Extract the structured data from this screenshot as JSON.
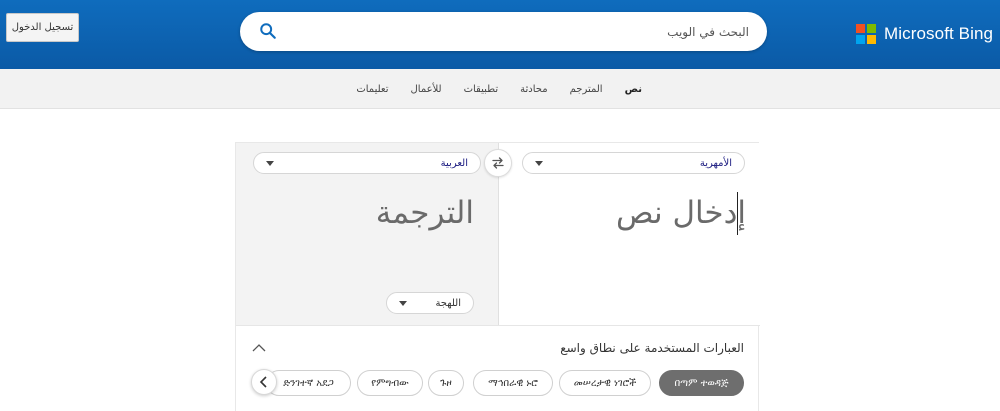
{
  "header": {
    "signin_label": "تسجيل الدخول",
    "search_placeholder": "البحث في الويب",
    "brand_name": "Microsoft Bing",
    "logo_colors": [
      "#f25022",
      "#7fba00",
      "#00a4ef",
      "#ffb900"
    ]
  },
  "tabs": [
    {
      "label": "نص",
      "active": true
    },
    {
      "label": "المترجم",
      "active": false
    },
    {
      "label": "محادثة",
      "active": false
    },
    {
      "label": "تطبيقات",
      "active": false
    },
    {
      "label": "للأعمال",
      "active": false
    },
    {
      "label": "تعليمات",
      "active": false
    }
  ],
  "translator": {
    "source_language": "الأمهرية",
    "target_language": "العربية",
    "source_placeholder": "إدخال نص",
    "target_placeholder": "الترجمة",
    "dialect_label": "اللهجة"
  },
  "phrases": {
    "title": "العبارات المستخدمة على نطاق واسع",
    "chips": [
      "በጣም ተወዳጅ",
      "መሠረታዊ ነገሮች",
      "ማኅበራዊ ኑሮ",
      "ጉዞ",
      "የምግብው",
      "ድንገተኛ አደጋ"
    ]
  }
}
